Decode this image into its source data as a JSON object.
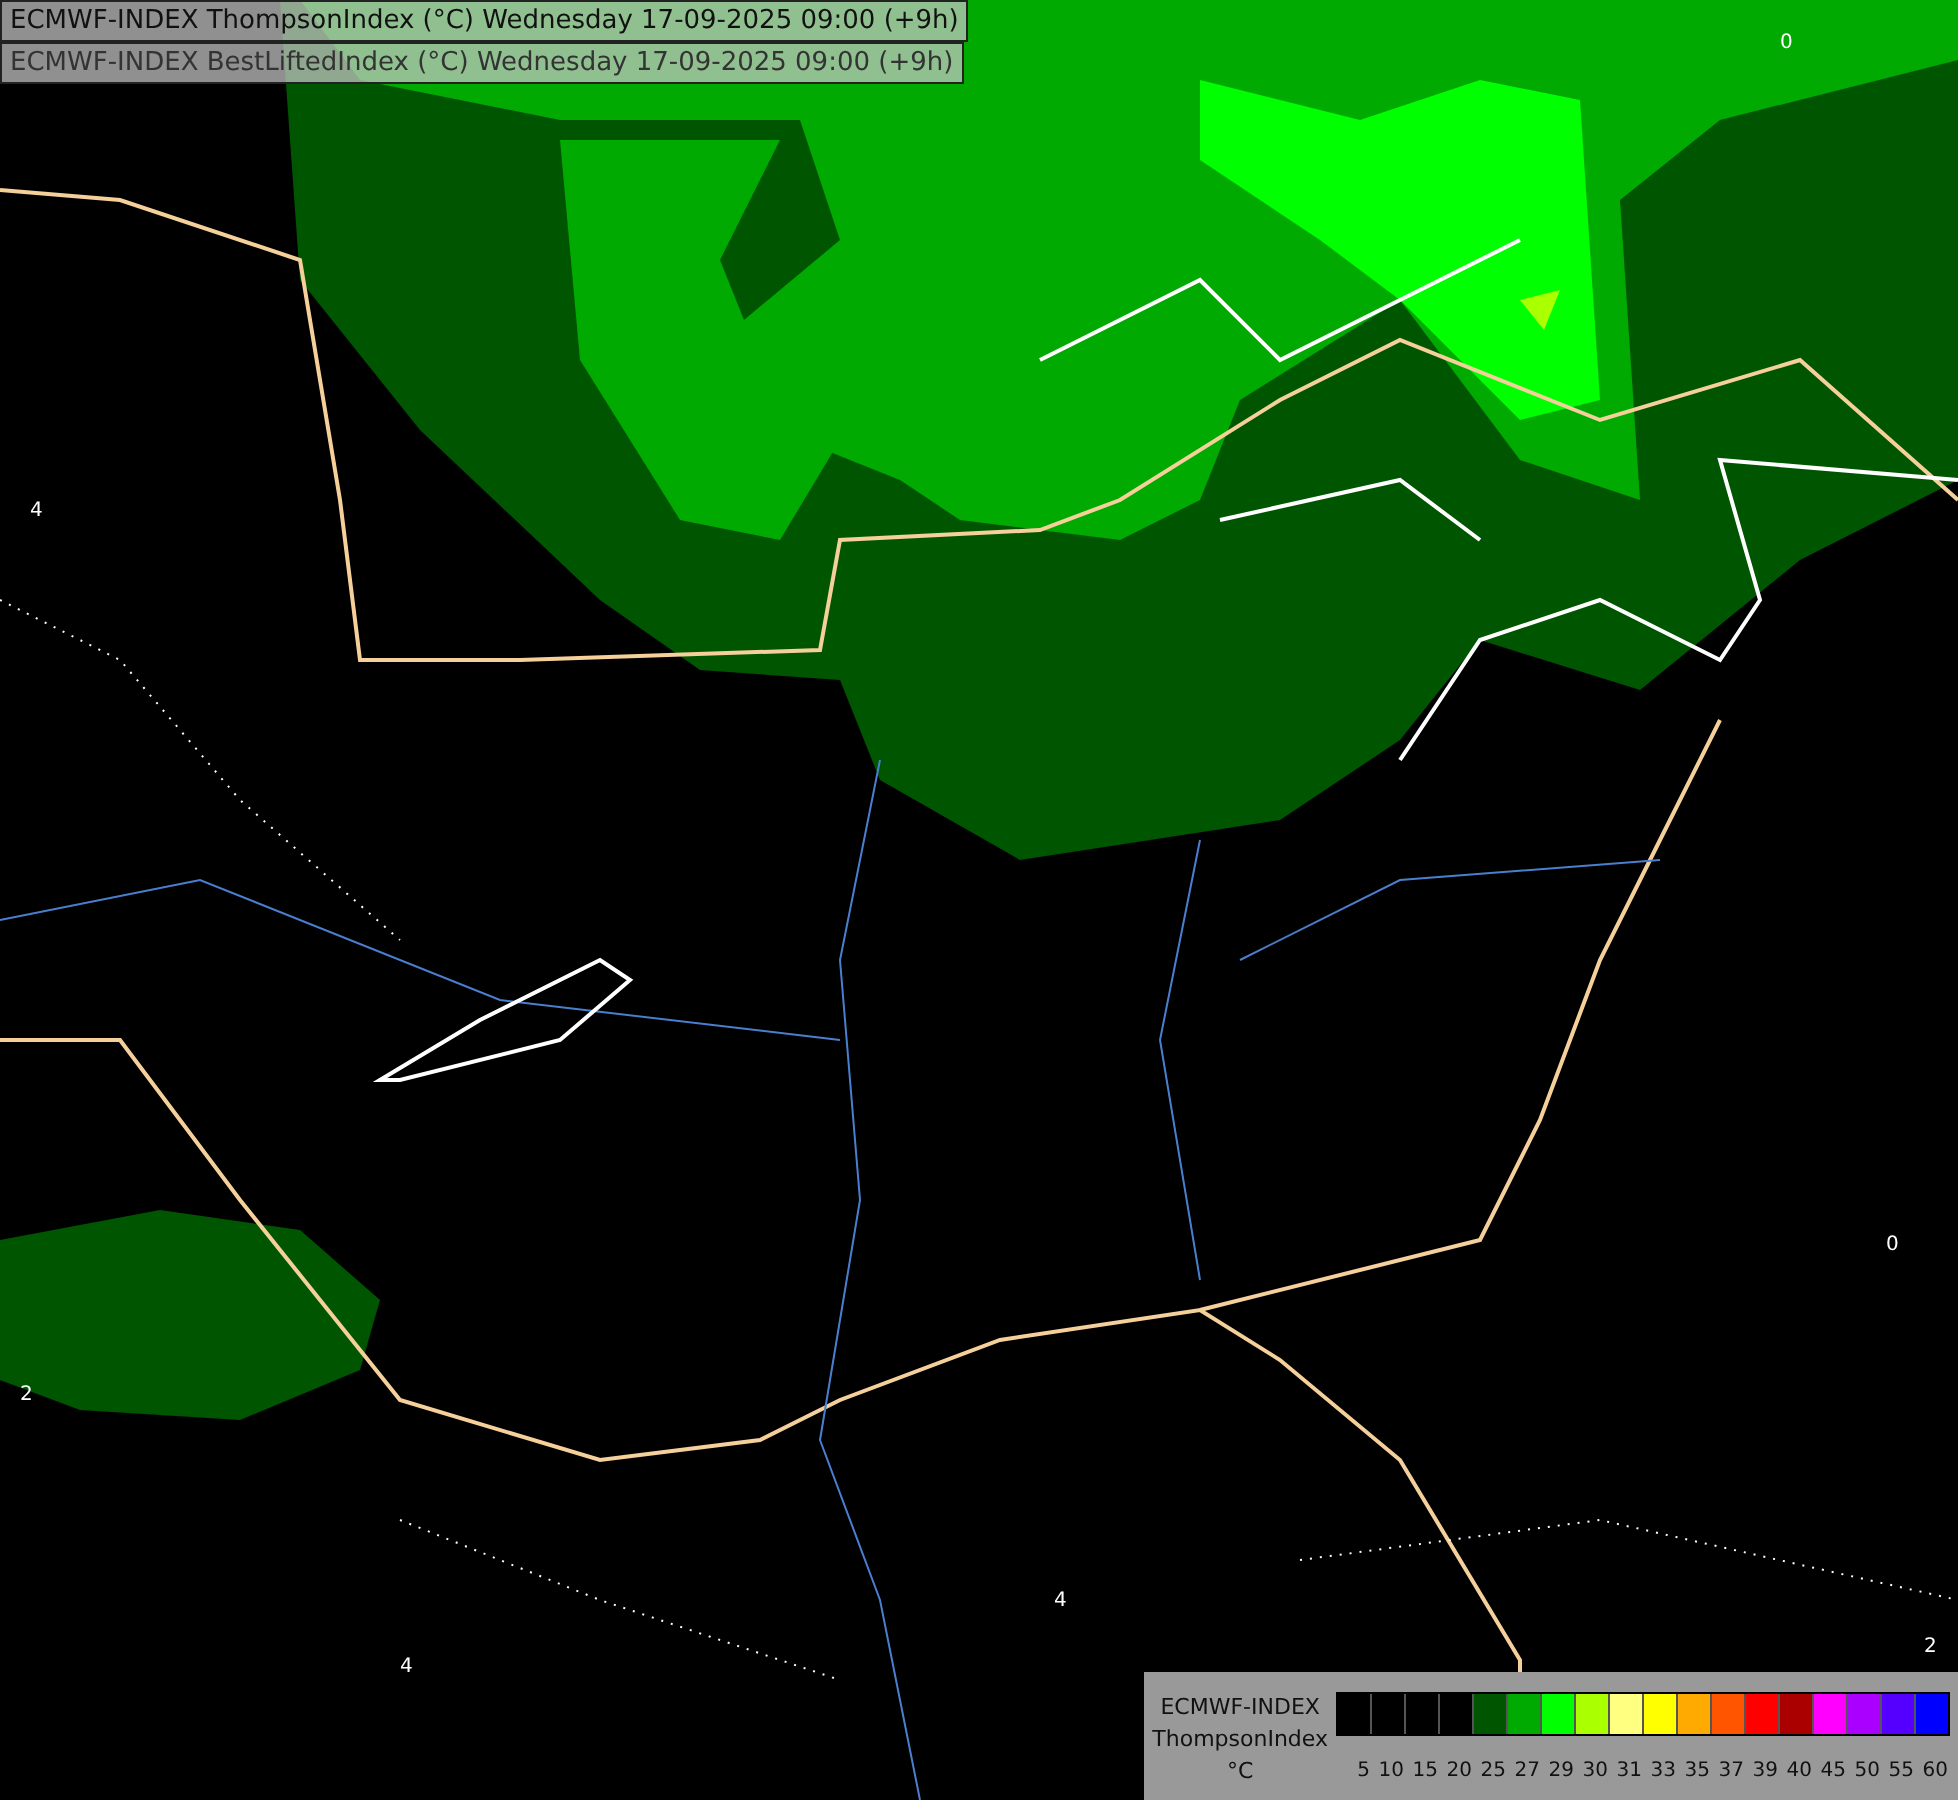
{
  "titles": [
    "ECMWF-INDEX ThompsonIndex (°C) Wednesday 17-09-2025 09:00 (+9h)",
    "ECMWF-INDEX BestLiftedIndex (°C) Wednesday 17-09-2025 09:00 (+9h)"
  ],
  "contour_labels": [
    "0",
    "4",
    "2",
    "4",
    "4",
    "0",
    "2"
  ],
  "legend": {
    "title_lines": [
      "ECMWF-INDEX",
      "ThompsonIndex",
      "°C"
    ],
    "bins": [
      {
        "label": "5",
        "color": "#000000"
      },
      {
        "label": "10",
        "color": "#000000"
      },
      {
        "label": "15",
        "color": "#000000"
      },
      {
        "label": "20",
        "color": "#000000"
      },
      {
        "label": "25",
        "color": "#005500"
      },
      {
        "label": "27",
        "color": "#00aa00"
      },
      {
        "label": "29",
        "color": "#00ff00"
      },
      {
        "label": "30",
        "color": "#aaff00"
      },
      {
        "label": "31",
        "color": "#ffff80"
      },
      {
        "label": "33",
        "color": "#ffff00"
      },
      {
        "label": "35",
        "color": "#ffaa00"
      },
      {
        "label": "37",
        "color": "#ff5500"
      },
      {
        "label": "39",
        "color": "#ff0000"
      },
      {
        "label": "40",
        "color": "#aa0000"
      },
      {
        "label": "45",
        "color": "#ff00ff"
      },
      {
        "label": "50",
        "color": "#aa00ff"
      },
      {
        "label": "55",
        "color": "#5500ff"
      },
      {
        "label": "60",
        "color": "#0000ff"
      }
    ]
  }
}
